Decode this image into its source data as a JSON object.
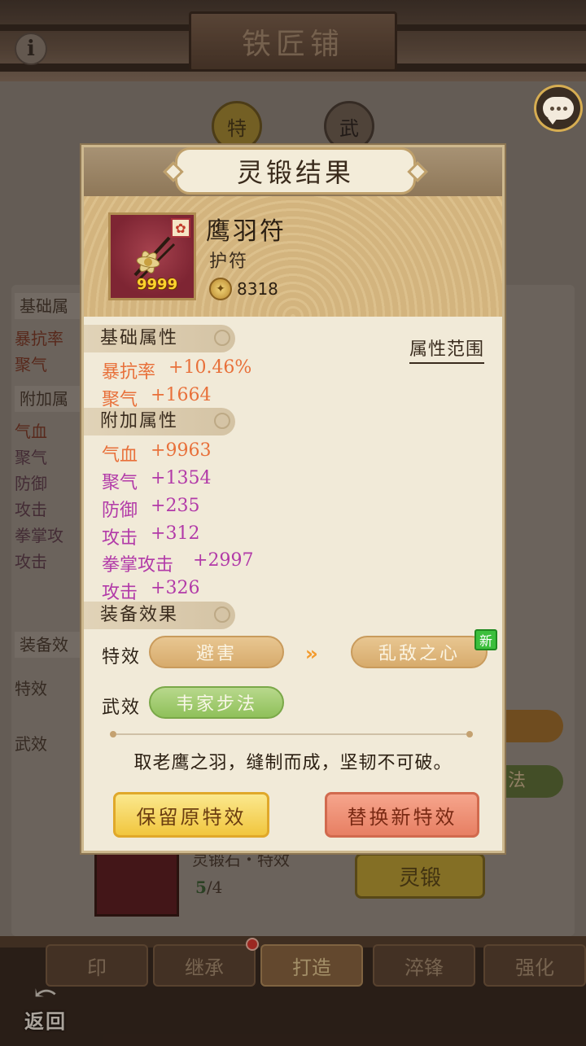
{
  "background": {
    "title": "铁匠铺",
    "info_icon": "info-icon",
    "badge1": "特",
    "badge2": "武",
    "left_stats": {
      "base_header": "基础属",
      "base": [
        "暴抗率",
        "聚气"
      ],
      "extra_header": "附加属",
      "extra": [
        "气血",
        "聚气",
        "防御",
        "攻击",
        "拳掌攻",
        "攻击"
      ],
      "effect_header": "装备效",
      "effect_special": "特效",
      "effect_martial": "武效"
    },
    "material_name": "灵锻石・特效",
    "material_count_have": "5",
    "material_count_need": "/4",
    "lingduan_button": "灵锻",
    "right_bar2_text": "法"
  },
  "chat_icon": "chat-bubble-icon",
  "nav": {
    "tabs": [
      "印",
      "继承",
      "打造",
      "淬锋",
      "强化"
    ],
    "active_tab": "打造",
    "back_label": "返回"
  },
  "modal": {
    "title": "灵锻结果",
    "item": {
      "name": "鹰羽符",
      "type": "护符",
      "quantity": "9999",
      "power": "8318"
    },
    "range_link": "属性范围",
    "base_section": "基础属性",
    "base_stats": [
      {
        "name": "暴抗率",
        "value": "+10.46%",
        "color": "orange"
      },
      {
        "name": "聚气",
        "value": "+1664",
        "color": "orange"
      }
    ],
    "extra_section": "附加属性",
    "extra_stats": [
      {
        "name": "气血",
        "value": "+9963",
        "color": "orange"
      },
      {
        "name": "聚气",
        "value": "+1354",
        "color": "purple"
      },
      {
        "name": "防御",
        "value": "+235",
        "color": "purple"
      },
      {
        "name": "攻击",
        "value": "+312",
        "color": "purple"
      },
      {
        "name": "拳掌攻击",
        "value": "+2997",
        "color": "purple"
      },
      {
        "name": "攻击",
        "value": "+326",
        "color": "purple"
      }
    ],
    "effect_section": "装备效果",
    "special_label": "特效",
    "special_old": "避害",
    "special_new": "乱敌之心",
    "new_badge": "新",
    "martial_label": "武效",
    "martial_value": "韦家步法",
    "description": "取老鹰之羽，缝制而成，坚韧不可破。",
    "keep_button": "保留原特效",
    "replace_button": "替换新特效"
  },
  "colors": {
    "orange_stat": "#e8703a",
    "purple_stat": "#b23aa8",
    "keep_button": "#f1c63e",
    "replace_button": "#e77f63",
    "new_badge": "#3cbf3c"
  }
}
